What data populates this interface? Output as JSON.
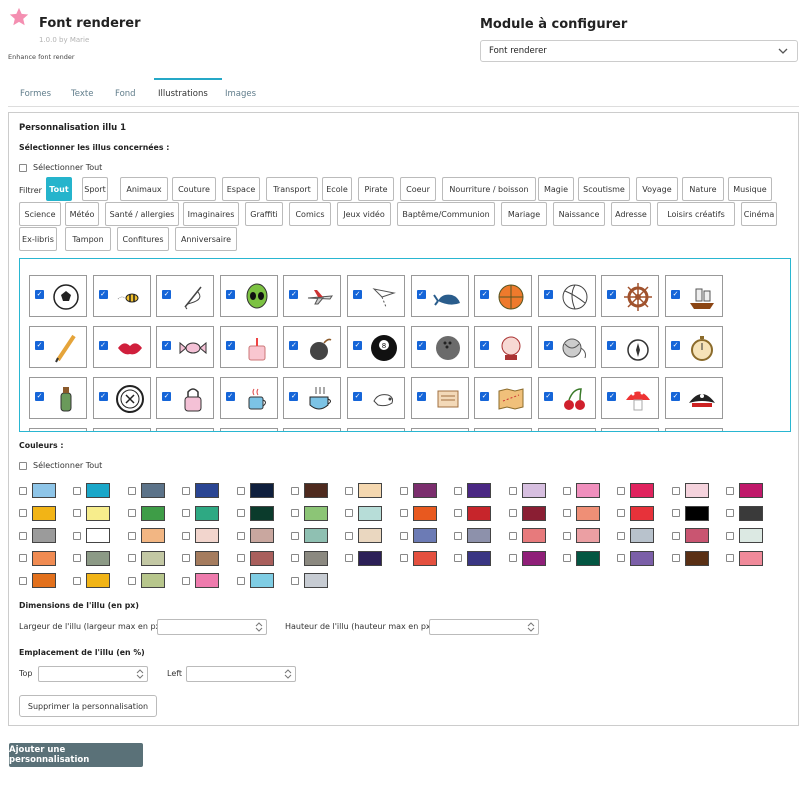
{
  "header": {
    "app_title": "Font renderer",
    "app_version": "1.0.0 by Marie",
    "app_description": "Enhance font render",
    "module_title": "Module à configurer",
    "module_select_value": "Font renderer",
    "logo_icon": "star-icon",
    "logo_color": "#f48fb1"
  },
  "tabs": [
    "Formes",
    "Texte",
    "Fond",
    "Illustrations",
    "Images"
  ],
  "active_tab": "Illustrations",
  "customization": {
    "title": "Personnalisation illu 1",
    "illus_label": "Sélectionner les illus concernées :",
    "select_all_label": "Sélectionner Tout",
    "filter_label": "Filtrer",
    "filters": [
      "Tout",
      "Sport",
      "Animaux",
      "Couture",
      "Espace",
      "Transport",
      "Ecole",
      "Pirate",
      "Coeur",
      "Nourriture / boisson",
      "Magie",
      "Scoutisme",
      "Voyage",
      "Nature",
      "Musique",
      "Science",
      "Météo",
      "Santé / allergies",
      "Imaginaires",
      "Graffiti",
      "Comics",
      "Jeux vidéo",
      "Baptême/Communion",
      "Mariage",
      "Naissance",
      "Adresse",
      "Loisirs créatifs",
      "Cinéma",
      "Ex-libris",
      "Tampon",
      "Confitures",
      "Anniversaire"
    ],
    "active_filter": "Tout",
    "illustrations": [
      {
        "name": "soccer-ball-icon",
        "checked": true
      },
      {
        "name": "bee-icon",
        "checked": true
      },
      {
        "name": "needle-thread-icon",
        "checked": true
      },
      {
        "name": "alien-icon",
        "checked": true
      },
      {
        "name": "airplane-icon",
        "checked": true
      },
      {
        "name": "paper-plane-icon",
        "checked": true
      },
      {
        "name": "whale-icon",
        "checked": true
      },
      {
        "name": "basketball-icon",
        "checked": true
      },
      {
        "name": "volleyball-icon",
        "checked": true
      },
      {
        "name": "ship-wheel-icon",
        "checked": true
      },
      {
        "name": "pirate-ship-icon",
        "checked": true
      },
      {
        "name": "pencil-icon",
        "checked": true
      },
      {
        "name": "lips-icon",
        "checked": true
      },
      {
        "name": "candy-icon",
        "checked": true
      },
      {
        "name": "birthday-cake-icon",
        "checked": true
      },
      {
        "name": "bomb-icon",
        "checked": true
      },
      {
        "name": "eight-ball-icon",
        "checked": true
      },
      {
        "name": "bowling-ball-icon",
        "checked": true
      },
      {
        "name": "crystal-ball-icon",
        "checked": true
      },
      {
        "name": "yarn-ball-icon",
        "checked": true
      },
      {
        "name": "compass-icon",
        "checked": true
      },
      {
        "name": "stopwatch-icon",
        "checked": true
      },
      {
        "name": "message-bottle-icon",
        "checked": true
      },
      {
        "name": "button-icon",
        "checked": true
      },
      {
        "name": "padlock-icon",
        "checked": true
      },
      {
        "name": "coffee-mug-icon",
        "checked": true
      },
      {
        "name": "teacup-icon",
        "checked": true
      },
      {
        "name": "chameleon-icon",
        "checked": true
      },
      {
        "name": "scroll-icon",
        "checked": true
      },
      {
        "name": "treasure-map-icon",
        "checked": true
      },
      {
        "name": "cherries-icon",
        "checked": true
      },
      {
        "name": "mushroom-icon",
        "checked": true
      },
      {
        "name": "pirate-hat-icon",
        "checked": true
      }
    ]
  },
  "colors": {
    "label": "Couleurs :",
    "select_all_label": "Sélectionner Tout",
    "rows": [
      [
        "#8ec5e8",
        "#1aa7c9",
        "#5c7389",
        "#2a4593",
        "#0f1f3d",
        "#4e2a1e",
        "#f5d8b0",
        "#7b2e6e",
        "#4a2783",
        "#d7bfe0",
        "#f08fbd",
        "#e0235e",
        "#f5d3dd",
        "#c0186a"
      ],
      [
        "#f2b416",
        "#f7ed8c",
        "#3e9d47",
        "#2ea983",
        "#0b3b2c",
        "#8cc576",
        "#b7ddd8",
        "#e8591f",
        "#c7252b",
        "#8a1e33",
        "#ef8f76",
        "#e7323a",
        "#000000",
        "#3a3a3a"
      ],
      [
        "#9b9b9b",
        "#ffffff",
        "#f2b683",
        "#f2d5cd",
        "#c9a79f",
        "#8fc0b2",
        "#ead7c0",
        "#6c7bb5",
        "#8d91ab",
        "#e77a7c",
        "#eb9fa3",
        "#b8c2cc",
        "#c95571",
        "#dce9e3"
      ],
      [
        "#f08b52",
        "#8c9a86",
        "#c3c8a4",
        "#a57c5e",
        "#a95f5c",
        "#8b8980",
        "#2c2057",
        "#e4503f",
        "#3a3683",
        "#8f1f78",
        "#035642",
        "#7b5fa8",
        "#5a3015",
        "#f08a9a"
      ],
      [
        "#e2701c",
        "#f1b416",
        "#b7c68c",
        "#ee7bad",
        "#7fcde4",
        "#c7ccd3"
      ]
    ]
  },
  "dimensions": {
    "title": "Dimensions de l'illu (en px)",
    "width_label": "Largeur de l'illu (largeur max en px)",
    "height_label": "Hauteur de l'illu (hauteur max en px)"
  },
  "placement": {
    "title": "Emplacement de l'illu (en %)",
    "top_label": "Top",
    "left_label": "Left"
  },
  "actions": {
    "delete_label": "Supprimer la personnalisation",
    "add_label": "Ajouter une personnalisation"
  }
}
